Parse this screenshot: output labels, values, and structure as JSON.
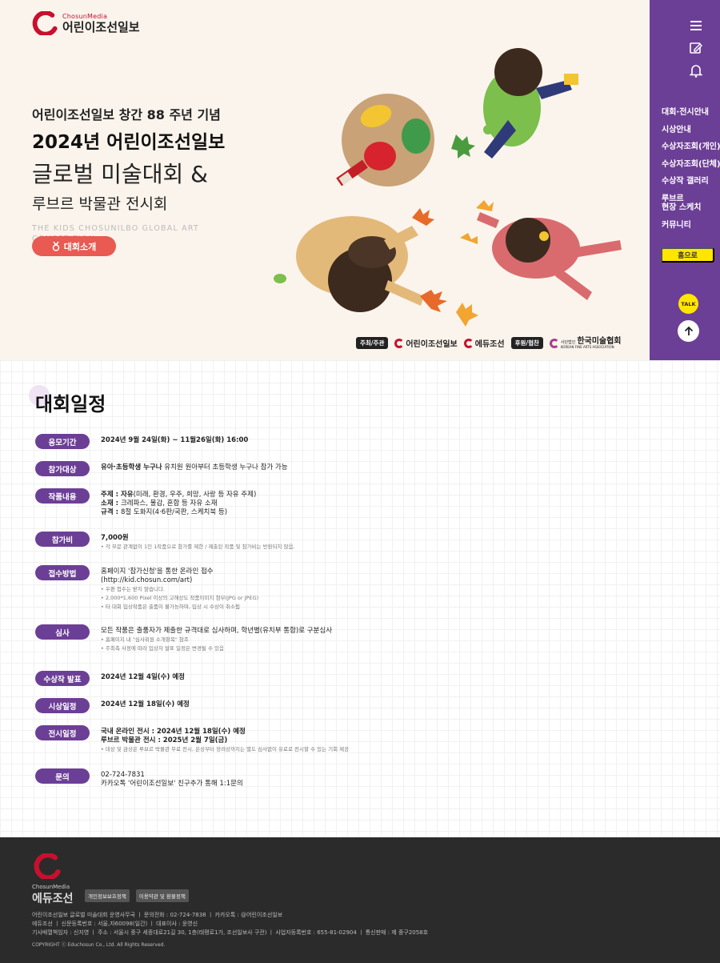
{
  "brand": {
    "logo_sub": "ChosunMedia",
    "logo_main": "어린이조선일보",
    "accent": "#c8102e",
    "purple": "#6c3f96"
  },
  "hero": {
    "line1": "어린이조선일보 창간 88 주년 기념",
    "line2": "2024년 어린이조선일보",
    "line3": "글로벌 미술대회 &",
    "line4": "루브르 박물관 전시회",
    "english": "THE KIDS CHOSUNILBO GLOBAL ART COMPETITION",
    "intro_button": "대회소개",
    "sponsor_host_label": "주최/주관",
    "sponsor_host_1": "어린이조선일보",
    "sponsor_host_2": "에듀조선",
    "sponsor_support_label": "후원/협찬",
    "sponsor_support_1": "한국미술협회",
    "sponsor_support_1_prefix": "사단법인",
    "sponsor_support_1_en": "KOREAN FINE ARTS ASSOCIATION"
  },
  "sidebar": {
    "icons": [
      "menu-icon",
      "edit-icon",
      "bell-icon"
    ],
    "items": [
      "대회·전시안내",
      "시상안내",
      "수상자조회(개인)",
      "수상자조회(단체)",
      "수상작 갤러리",
      "루브르\n현장 스케치",
      "커뮤니티"
    ],
    "home_button": "홈으로",
    "talk_label": "TALK"
  },
  "schedule": {
    "title": "대회일정",
    "rows": [
      {
        "label": "응모기간",
        "lines": [
          {
            "b": "2024년 9월 24일(화) ~ 11월26일(화) 16:00",
            "t": ""
          }
        ],
        "notes": []
      },
      {
        "label": "참가대상",
        "lines": [
          {
            "b": "유아·초등학생 누구나",
            "t": " 유치원 원아부터 초등학생 누구나 참가 가능"
          }
        ],
        "notes": []
      },
      {
        "label": "작품내용",
        "lines": [
          {
            "b": "주제 : 자유",
            "t": "(미래, 환경, 우주, 희망, 사랑 등 자유 주제)"
          },
          {
            "b": "소재 : ",
            "t": "크레파스, 물감, 혼합 등 자유 소재"
          },
          {
            "b": "규격 : ",
            "t": "8절 도화지(4·6판/국판, 스케치북 등)"
          }
        ],
        "notes": []
      },
      {
        "label": "참가비",
        "lines": [
          {
            "b": "7,000원",
            "t": ""
          }
        ],
        "notes": [
          "• 각 부문 관계없이 1인 1작품으로 참가를 제한 / 제출된 작품 및 참가비는 반환되지 않음."
        ]
      },
      {
        "label": "접수방법",
        "lines": [
          {
            "b": "",
            "t": "홈페이지 '참가신청'을 통한 온라인 접수"
          },
          {
            "b": "",
            "t": "(http://kid.chosun.com/art)"
          }
        ],
        "notes": [
          "• 우편 접수는 받지 않습니다.",
          "• 2,000*1,600 Pixel 이상의 고해상도 작품이미지 첨부(JPG or JPEG)",
          "• 타 대회 입상작품은 출품이 불가능하며, 입상 시 수상이 취소됨"
        ]
      },
      {
        "label": "심사",
        "lines": [
          {
            "b": "",
            "t": "모든 작품은 출품자가 제출한 규격대로 심사하며, 학년별(유치부 통합)로 구분심사"
          }
        ],
        "notes": [
          "• 홈페이지 내 \"심사위원 소개항목\" 참조",
          "• 주최측 사정에 따라 입상자 발표 일정은 변경될 수 있음"
        ]
      },
      {
        "label": "수상작 발표",
        "lines": [
          {
            "b": "2024년 12월 4일(수) 예정",
            "t": ""
          }
        ],
        "notes": []
      },
      {
        "label": "시상일정",
        "lines": [
          {
            "b": "2024년 12월 18일(수) 예정",
            "t": ""
          }
        ],
        "notes": []
      },
      {
        "label": "전시일정",
        "lines": [
          {
            "b": "국내 온라인 전시 : 2024년 12월 18일(수) 예정",
            "t": ""
          },
          {
            "b": "루브르 박물관 전시 : 2025년 2월 7일(금)",
            "t": ""
          }
        ],
        "notes": [
          "• 대상 및 금상은 루브르 박물관 무료 전시, 은상부터 장려상까지는 별도 심사없이 유료로 전시할 수 있는 기회 제공"
        ]
      },
      {
        "label": "문의",
        "lines": [
          {
            "b": "",
            "t": "02-724-7831"
          },
          {
            "b": "",
            "t": "카카오톡 '어린이조선일보' 친구추가 통해 1:1문의"
          }
        ],
        "notes": []
      }
    ]
  },
  "footer": {
    "logo_sub": "ChosunMedia",
    "logo_main": "에듀조선",
    "links": [
      "개인정보보호정책",
      "이용약관 및 환불정책"
    ],
    "info": [
      "어린이조선일보 글로벌 미술대회 운영사무국  ㅣ  문의전화 : 02-724-7838  ㅣ  카카오톡 : @어린이조선일보",
      "에듀조선  ㅣ  신문등록번호 : 서울,자60098(일간)  ㅣ  대표이사 : 윤영신",
      "기사배열책임자 : 신지영  ㅣ  주소 : 서울시 중구 세종대로21길 30, 1층(태평로1가, 조선일보사 구관)  ㅣ  사업자등록번호 : 655-81-02904  ㅣ  통신판매 : 제 중구2058호"
    ],
    "copyright": "COPYRIGHT ⓒ Educhosun Co., Ltd. All Rights Reserved."
  }
}
